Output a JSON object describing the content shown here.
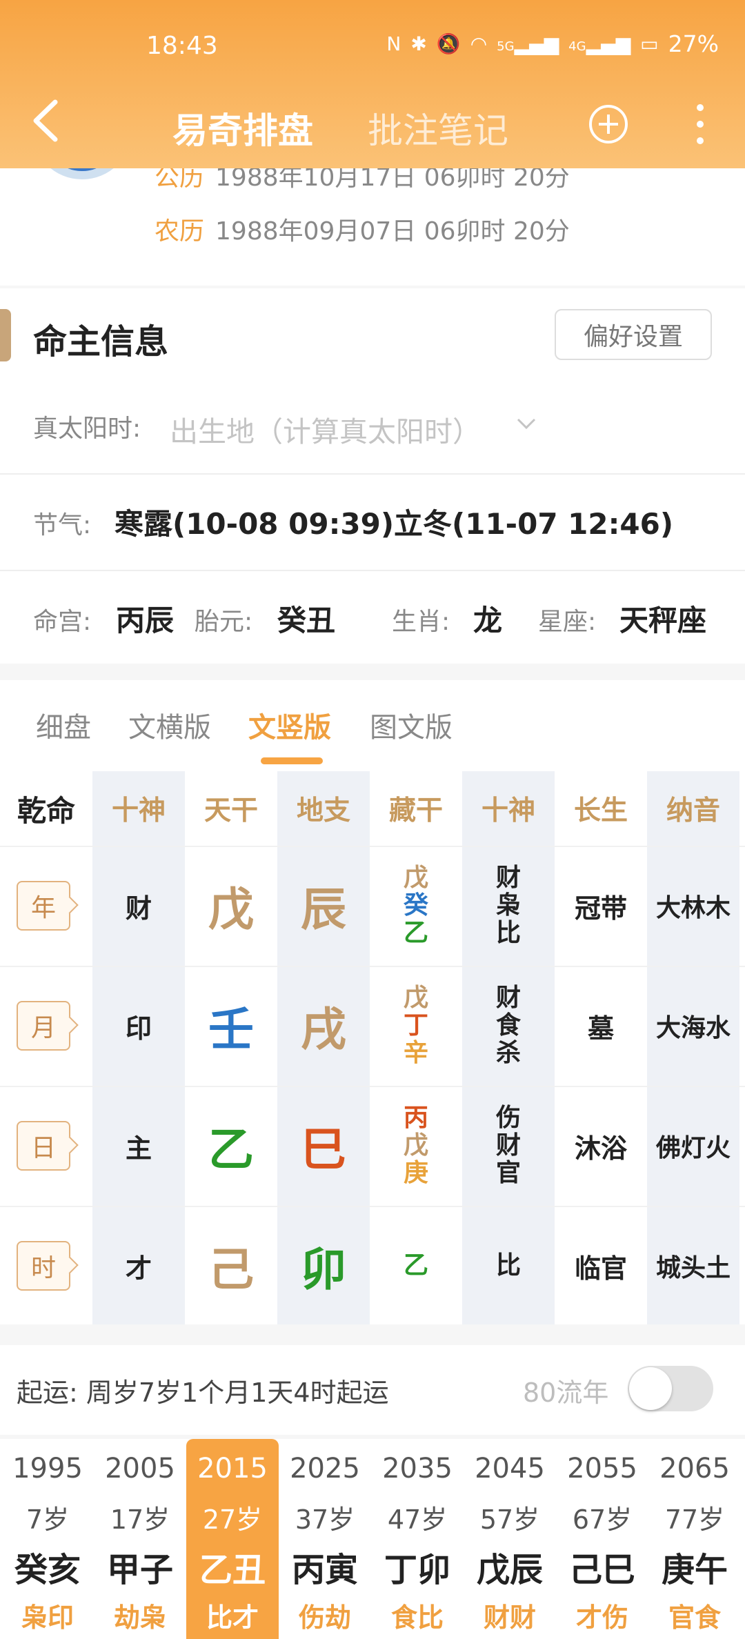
{
  "status_bar": {
    "time": "18:43",
    "battery": "27%",
    "net5g": "5G",
    "net4g": "4G"
  },
  "nav": {
    "title": "易奇排盘",
    "title2": "批注笔记"
  },
  "dates": {
    "solar_label": "公历",
    "solar": "1988年10月17日 06卯时 20分",
    "lunar_label": "农历",
    "lunar": "1988年09月07日 06卯时 20分"
  },
  "section": {
    "title": "命主信息",
    "pref_button": "偏好设置"
  },
  "true_solar": {
    "label": "真太阳时:",
    "placeholder": "出生地（计算真太阳时）"
  },
  "jieqi": {
    "label": "节气:",
    "value": "寒露(10-08 09:39)立冬(11-07 12:46)"
  },
  "info": {
    "minggong_label": "命宫:",
    "minggong": "丙辰",
    "taiyuan_label": "胎元:",
    "taiyuan": "癸丑",
    "shengxiao_label": "生肖:",
    "shengxiao": "龙",
    "xingzuo_label": "星座:",
    "xingzuo": "天秤座"
  },
  "tabs": [
    "细盘",
    "文横版",
    "文竖版",
    "图文版"
  ],
  "active_tab": "文竖版",
  "grid": {
    "gender": "乾命",
    "headers": [
      "十神",
      "天干",
      "地支",
      "藏干",
      "十神",
      "长生",
      "纳音"
    ],
    "rows": [
      {
        "pillar": "年",
        "shishen": "财",
        "tiangan": "戊",
        "dizhi": "辰",
        "canggan": [
          "戊",
          "癸",
          "乙"
        ],
        "canggan_shishen": [
          "财",
          "枭",
          "比"
        ],
        "changsheng": "冠带",
        "nayin": "大林木"
      },
      {
        "pillar": "月",
        "shishen": "印",
        "tiangan": "壬",
        "dizhi": "戌",
        "canggan": [
          "戊",
          "丁",
          "辛"
        ],
        "canggan_shishen": [
          "财",
          "食",
          "杀"
        ],
        "changsheng": "墓",
        "nayin": "大海水"
      },
      {
        "pillar": "日",
        "shishen": "主",
        "tiangan": "乙",
        "dizhi": "巳",
        "canggan": [
          "丙",
          "戊",
          "庚"
        ],
        "canggan_shishen": [
          "伤",
          "财",
          "官"
        ],
        "changsheng": "沐浴",
        "nayin": "佛灯火"
      },
      {
        "pillar": "时",
        "shishen": "才",
        "tiangan": "己",
        "dizhi": "卯",
        "canggan": [
          "乙"
        ],
        "canggan_shishen": [
          "比"
        ],
        "changsheng": "临官",
        "nayin": "城头土"
      }
    ]
  },
  "colors": {
    "earth": "#c19a6b",
    "water": "#2a76c6",
    "wood": "#2a9a2a",
    "fire": "#d9531e",
    "metal": "#e8a23a",
    "accent": "#f7a443"
  },
  "element_colors": {
    "tiangan": [
      "earth",
      "water",
      "wood",
      "earth"
    ],
    "dizhi": [
      "earth",
      "earth",
      "fire",
      "wood"
    ],
    "canggan": [
      [
        "earth",
        "water",
        "wood"
      ],
      [
        "earth",
        "fire",
        "metal"
      ],
      [
        "fire",
        "earth",
        "metal"
      ],
      [
        "wood"
      ]
    ]
  },
  "qiyun": {
    "text": "起运: 周岁7岁1个月1天4时起运",
    "liunian_label": "80流年",
    "toggle_on": false
  },
  "dayun": [
    {
      "year": "1995",
      "age": "7岁",
      "ganzhi": "癸亥",
      "shishen": "枭印"
    },
    {
      "year": "2005",
      "age": "17岁",
      "ganzhi": "甲子",
      "shishen": "劫枭"
    },
    {
      "year": "2015",
      "age": "27岁",
      "ganzhi": "乙丑",
      "shishen": "比才"
    },
    {
      "year": "2025",
      "age": "37岁",
      "ganzhi": "丙寅",
      "shishen": "伤劫"
    },
    {
      "year": "2035",
      "age": "47岁",
      "ganzhi": "丁卯",
      "shishen": "食比"
    },
    {
      "year": "2045",
      "age": "57岁",
      "ganzhi": "戊辰",
      "shishen": "财财"
    },
    {
      "year": "2055",
      "age": "67岁",
      "ganzhi": "己巳",
      "shishen": "才伤"
    },
    {
      "year": "2065",
      "age": "77岁",
      "ganzhi": "庚午",
      "shishen": "官食"
    }
  ],
  "active_dayun": "2015"
}
